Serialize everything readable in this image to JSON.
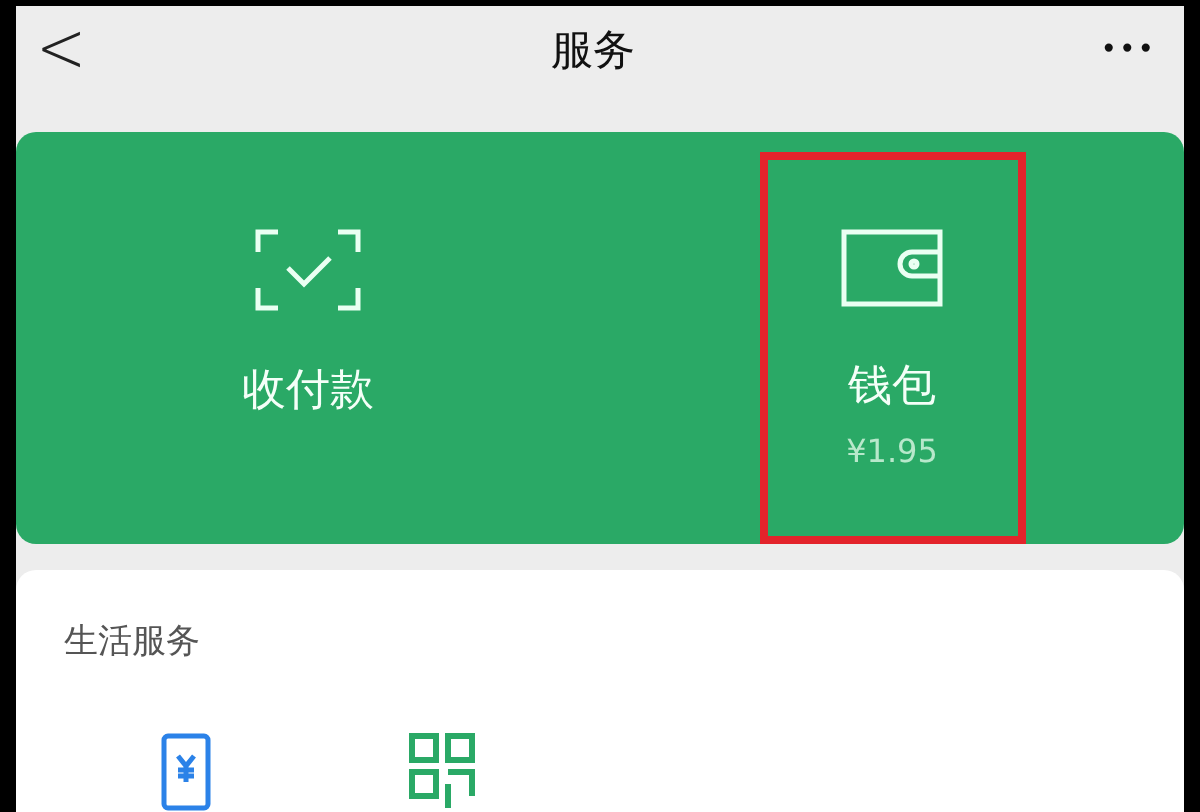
{
  "nav_bar": {
    "back": "<",
    "title": "服务",
    "more": "•••"
  },
  "wallet_card": {
    "items": [
      {
        "kind": "pay",
        "label": "收付款",
        "highlighted": false
      },
      {
        "kind": "wallet",
        "label": "钱包",
        "balance": "¥1.95",
        "highlighted": true
      }
    ]
  },
  "life_services": {
    "title": "生活服务",
    "items": [
      {
        "kind": "phone"
      },
      {
        "kind": "grid"
      }
    ]
  }
}
